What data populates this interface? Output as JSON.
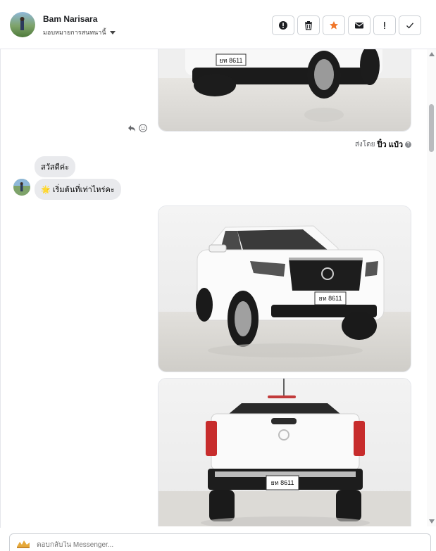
{
  "header": {
    "contact_name": "Bam Narisara",
    "assign_label": "มอบหมายการสนทนานี้"
  },
  "conversation": {
    "sent_by_prefix": "ส่งโดย",
    "sent_by_name": "ปิ๋ว แป๋ว",
    "help_glyph": "?",
    "incoming": [
      {
        "text": "สวัสดีค่ะ"
      },
      {
        "text": "🌟 เริ่มต้นที่เท่าไหร่คะ"
      }
    ]
  },
  "images": [
    {
      "plate": "ยท 8611",
      "view": "front-lower"
    },
    {
      "plate": "ยท 8611",
      "view": "front-three-quarter"
    },
    {
      "plate": "ยท 8611",
      "view": "rear"
    }
  ],
  "composer": {
    "placeholder": "ตอบกลับใน Messenger..."
  },
  "colors": {
    "accent_star": "#f0772b",
    "bubble_in": "#e9eaed",
    "border": "#ccd0d5"
  }
}
